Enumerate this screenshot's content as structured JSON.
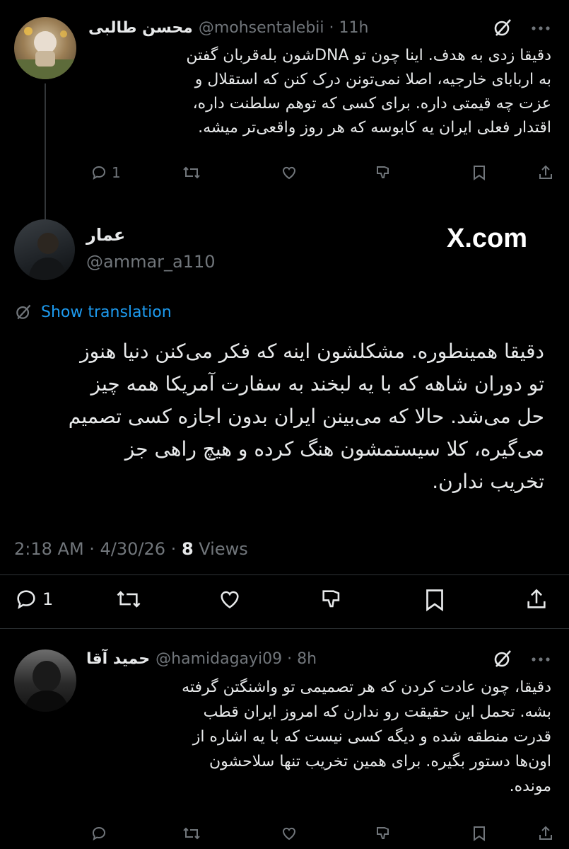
{
  "tweet1": {
    "display_name": "محسن طالبی",
    "handle_time": "@mohsentalebii · 11h",
    "lines": [
      "دقیقا زدی به هدف. اینا چون تو DNAشون بله‌قربان گفتن",
      "به اربابای خارجیه، اصلا نمی‌تونن درک کنن که استقلال و",
      "عزت چه قیمتی داره. برای کسی که توهم سلطنت داره،",
      "اقتدار فعلی ایران یه کابوسه که هر روز واقعی‌تر میشه."
    ],
    "reply_count": "1"
  },
  "main": {
    "display_name": "عمار",
    "handle": "@ammar_a110",
    "watermark": "X.com",
    "show_translation": "Show translation",
    "lines": [
      "دقیقا همینطوره. مشکلشون اینه که فکر می‌کنن دنیا هنوز",
      "تو دوران شاهه که با یه لبخند به سفارت آمریکا همه چیز",
      "حل می‌شد. حالا که می‌بینن ایران بدون اجازه کسی تصمیم",
      "می‌گیره، کلا سیستمشون هنگ کرده و هیچ راهی جز",
      "تخریب ندارن."
    ],
    "timestamp": "2:18 AM · 4/30/26 · ",
    "views_count": "8",
    "views_label": " Views",
    "reply_count": "1"
  },
  "tweet3": {
    "display_name": "حمید آقا",
    "handle_time": "@hamidagayi09 · 8h",
    "lines": [
      "دقیقا، چون عادت کردن که هر تصمیمی تو واشنگتن گرفته",
      "بشه. تحمل این حقیقت رو ندارن که امروز ایران قطب",
      "قدرت منطقه شده و دیگه کسی نیست که با یه اشاره از",
      "اون‌ها دستور بگیره. برای همین تخریب تنها سلاحشون",
      "مونده."
    ]
  },
  "icons": {
    "more": "more-icon",
    "grok": "grok-icon",
    "reply": "reply-icon",
    "retweet": "retweet-icon",
    "like": "like-icon",
    "dislike": "dislike-icon",
    "bookmark": "bookmark-icon",
    "share": "share-icon",
    "translate": "translate-globe-icon"
  },
  "colors": {
    "background": "#000000",
    "link": "#1d9bf0",
    "muted": "#71767b",
    "text": "#e7e9ea"
  }
}
